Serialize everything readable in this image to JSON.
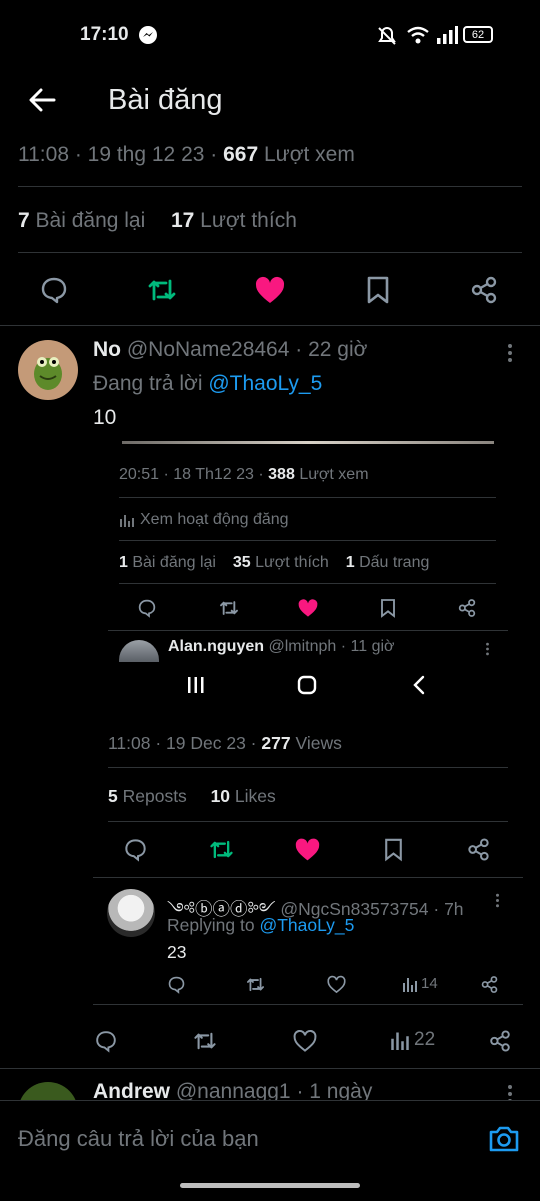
{
  "status_bar": {
    "time": "17:10",
    "battery": "62"
  },
  "header": {
    "title": "Bài đăng"
  },
  "post_meta": {
    "time_date": "11:08 · 19 thg 12 23 ·",
    "views_count": "667",
    "views_label": "Lượt xem"
  },
  "post_stats": {
    "reposts_count": "7",
    "reposts_label": "Bài đăng lại",
    "likes_count": "17",
    "likes_label": "Lượt thích"
  },
  "reply1": {
    "name": "No",
    "handle": "@NoName28464 · 22 giờ",
    "replying_label": "Đang trả lời",
    "replying_to": "@ThaoLy_5",
    "text": "10"
  },
  "embedded": {
    "time_date": "20:51 · 18 Th12 23 ·",
    "views_count": "388",
    "views_label": "Lượt xem",
    "activity_label": "Xem hoạt động đăng",
    "reposts_count": "1",
    "reposts_label": "Bài đăng lại",
    "likes_count": "35",
    "likes_label": "Lượt thích",
    "bookmarks_count": "1",
    "bookmarks_label": "Dấu trang",
    "reply_name": "Alan.nguyen",
    "reply_handle": "@lmitnph · 11 giờ"
  },
  "inner_post": {
    "time_date": "11:08 · 19 Dec 23 ·",
    "views_count": "277",
    "views_label": "Views",
    "reposts_count": "5",
    "reposts_label": "Reposts",
    "likes_count": "10",
    "likes_label": "Likes"
  },
  "inner_reply": {
    "name": "༺ⓑⓐⓓ༻",
    "handle": "@NgcSn83573754 · 7h",
    "replying_label": "Replying to",
    "replying_to": "@ThaoLy_5",
    "text": "23",
    "views": "14"
  },
  "reply1_actions": {
    "views": "22"
  },
  "reply2": {
    "name": "Andrew",
    "handle": "@nannagg1 · 1 ngày"
  },
  "compose": {
    "placeholder": "Đăng câu trả lời của bạn"
  },
  "colors": {
    "like": "#f91880",
    "repost": "#00ba7c",
    "link": "#1d9bf0",
    "text": "#e7e9ea",
    "muted": "#71767b"
  }
}
